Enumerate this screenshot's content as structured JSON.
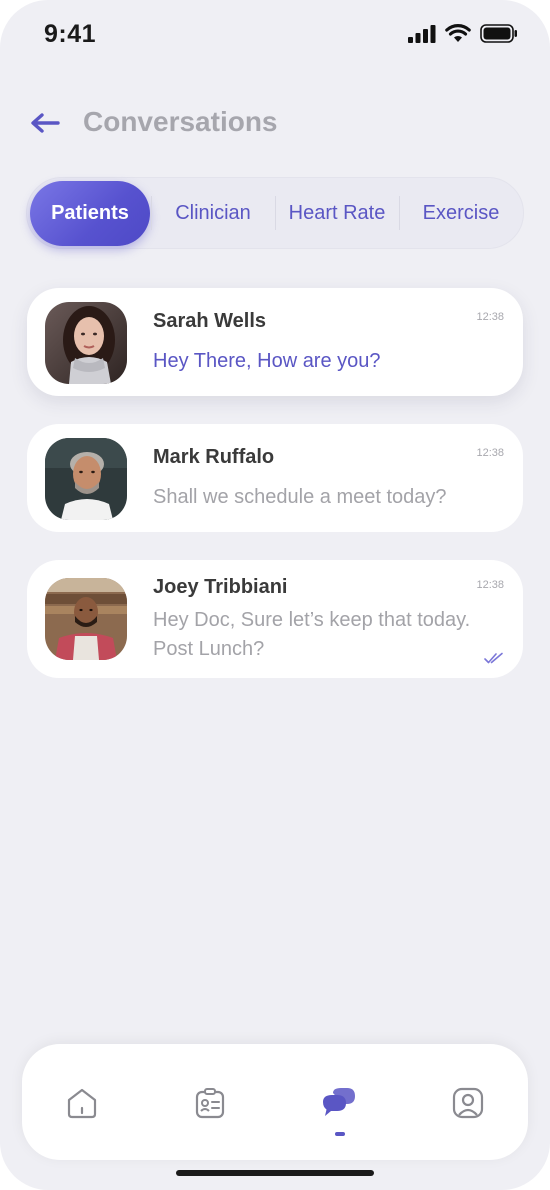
{
  "status_bar": {
    "time": "9:41"
  },
  "header": {
    "title": "Conversations"
  },
  "tabs": [
    {
      "label": "Patients",
      "active": true
    },
    {
      "label": "Clinician",
      "active": false
    },
    {
      "label": "Heart Rate",
      "active": false
    },
    {
      "label": "Exercise",
      "active": false
    }
  ],
  "conversations": [
    {
      "name": "Sarah Wells",
      "message": "Hey There, How are you?",
      "time": "12:38",
      "unread": true
    },
    {
      "name": "Mark Ruffalo",
      "message": "Shall we schedule a meet today?",
      "time": "12:38",
      "unread": false
    },
    {
      "name": "Joey Tribbiani",
      "message_line1": "Hey Doc, Sure let’s keep that today.",
      "message_line2": "Post Lunch?",
      "time": "12:38",
      "unread": false,
      "read_receipt": "double-check-icon"
    }
  ],
  "bottom_nav": {
    "items": [
      "home-icon",
      "patient-card-icon",
      "chat-icon",
      "profile-icon"
    ],
    "active": "chat-icon"
  },
  "colors": {
    "accent": "#5a56c4",
    "background": "#efeff4",
    "title_gray": "#a6a6ad"
  }
}
